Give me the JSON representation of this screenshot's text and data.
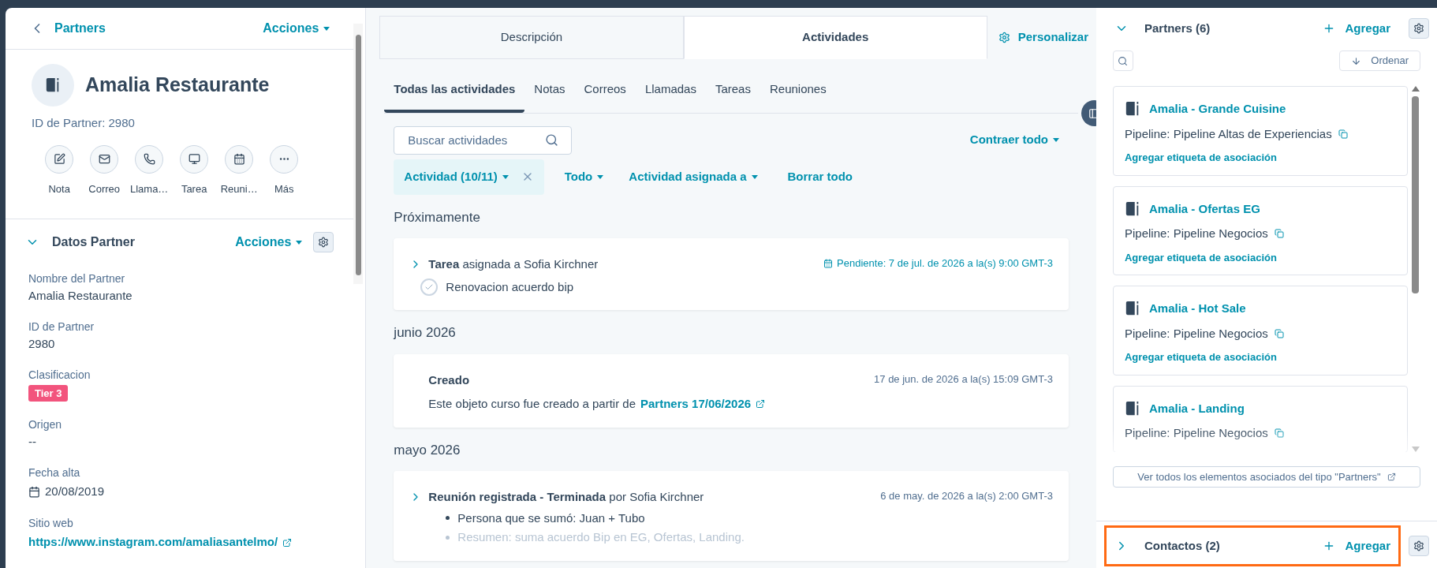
{
  "left_panel": {
    "back_link": "Partners",
    "actions": "Acciones",
    "record": {
      "name": "Amalia Restaurante",
      "id_label": "ID de Partner: 2980"
    },
    "quick_actions": [
      {
        "kind": "note",
        "label": "Nota"
      },
      {
        "kind": "email",
        "label": "Correo"
      },
      {
        "kind": "call",
        "label": "Llama…"
      },
      {
        "kind": "task",
        "label": "Tarea"
      },
      {
        "kind": "meeting",
        "label": "Reuni…"
      },
      {
        "kind": "more",
        "label": "Más"
      }
    ],
    "section": {
      "title": "Datos Partner",
      "expanded": true,
      "actions": "Acciones",
      "fields": [
        {
          "kind": "text",
          "label": "Nombre del Partner",
          "value": "Amalia Restaurante"
        },
        {
          "kind": "text",
          "label": "ID de Partner",
          "value": "2980"
        },
        {
          "kind": "tag",
          "label": "Clasificacion",
          "value": "Tier 3"
        },
        {
          "kind": "text",
          "label": "Origen",
          "value": "--"
        },
        {
          "kind": "date",
          "label": "Fecha alta",
          "value": "20/08/2019"
        },
        {
          "kind": "link",
          "label": "Sitio web",
          "value": "https://www.instagram.com/amaliasantelmo/"
        }
      ]
    }
  },
  "middle_panel": {
    "tabs": [
      {
        "label": "Descripción",
        "selected": false
      },
      {
        "label": "Actividades",
        "selected": true
      }
    ],
    "customize": "Personalizar",
    "subtabs": [
      {
        "label": "Todas las actividades",
        "selected": true
      },
      {
        "label": "Notas",
        "selected": false
      },
      {
        "label": "Correos",
        "selected": false
      },
      {
        "label": "Llamadas",
        "selected": false
      },
      {
        "label": "Tareas",
        "selected": false
      },
      {
        "label": "Reuniones",
        "selected": false
      }
    ],
    "search": {
      "placeholder": "Buscar actividades"
    },
    "collapse_all": "Contraer todo",
    "filters": [
      {
        "kind": "chip",
        "label": "Actividad (10/11)"
      },
      {
        "kind": "dropdown",
        "label": "Todo"
      },
      {
        "kind": "dropdown",
        "label": "Actividad asignada a"
      },
      {
        "kind": "link",
        "label": "Borrar todo"
      }
    ],
    "groups": [
      {
        "heading": "Próximamente",
        "items": [
          {
            "kind": "task",
            "title": "**Tarea** asignada a Sofia Kirchner",
            "due": "Pendiente: 7 de jul. de 2026 a la(s) 9:00 GMT-3",
            "task_name": "Renovacion acuerdo bip",
            "completed": false
          }
        ]
      },
      {
        "heading": "junio 2026",
        "items": [
          {
            "kind": "created",
            "title": "Creado",
            "timestamp": "17 de jun. de 2026 a la(s) 15:09 GMT-3",
            "body": "Este objeto curso fue creado a partir de",
            "link": "Partners 17/06/2026"
          }
        ]
      },
      {
        "heading": "mayo 2026",
        "items": [
          {
            "kind": "meeting",
            "title": "**Reunión registrada - Terminada** por Sofia Kirchner",
            "timestamp": "6 de may. de 2026 a la(s) 2:00 GMT-3",
            "bullets": [
              {
                "text": "Persona que se sumó: Juan + Tubo",
                "faded": false
              },
              {
                "text": "Resumen: suma acuerdo Bip en EG, Ofertas, Landing.",
                "faded": true
              }
            ]
          }
        ]
      }
    ]
  },
  "right_panel": {
    "sections": [
      {
        "title": "Partners (6)",
        "expanded": true,
        "highlighted": false,
        "add": "Agregar",
        "sort": "Ordenar",
        "cards": [
          {
            "name": "Amalia - Grande Cuisine",
            "pipeline": "Pipeline: Pipeline Altas de Experiencias",
            "label_link": "Agregar etiqueta de asociación"
          },
          {
            "name": "Amalia - Ofertas EG",
            "pipeline": "Pipeline: Pipeline Negocios",
            "label_link": "Agregar etiqueta de asociación"
          },
          {
            "name": "Amalia - Hot Sale",
            "pipeline": "Pipeline: Pipeline Negocios",
            "label_link": "Agregar etiqueta de asociación"
          },
          {
            "name": "Amalia - Landing",
            "pipeline": "Pipeline: Pipeline Negocios"
          }
        ],
        "view_all": "Ver todos los elementos asociados del tipo \"Partners\""
      },
      {
        "title": "Contactos (2)",
        "expanded": false,
        "highlighted": true,
        "add": "Agregar"
      }
    ]
  }
}
